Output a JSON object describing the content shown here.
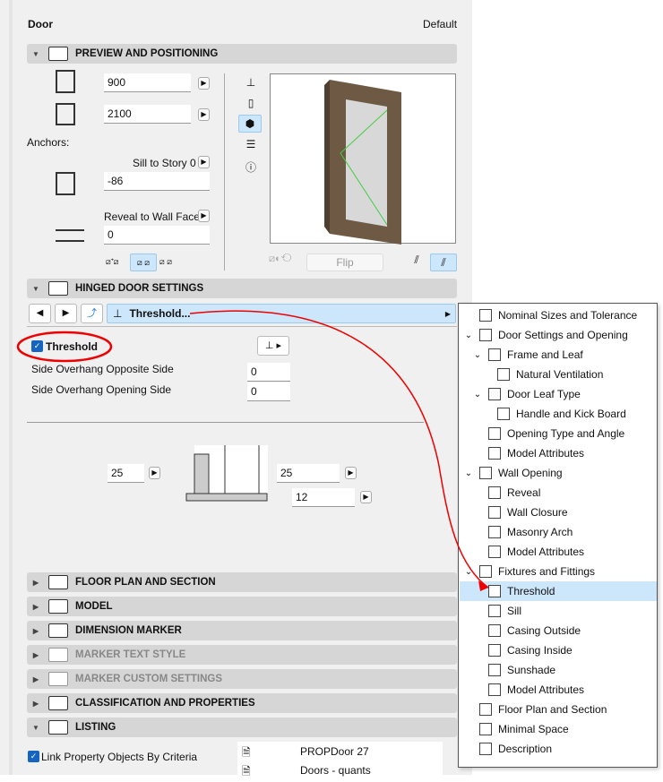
{
  "header": {
    "title": "Door",
    "preset": "Default"
  },
  "sections": {
    "preview": "PREVIEW AND POSITIONING",
    "hinged": "HINGED DOOR SETTINGS",
    "floor": "FLOOR PLAN AND SECTION",
    "model": "MODEL",
    "dimension": "DIMENSION MARKER",
    "marker_text": "MARKER TEXT STYLE",
    "marker_custom": "MARKER CUSTOM SETTINGS",
    "classification": "CLASSIFICATION AND PROPERTIES",
    "listing": "LISTING"
  },
  "preview": {
    "width": "900",
    "height": "2100",
    "anchors_label": "Anchors:",
    "sill_label": "Sill to Story 0",
    "sill_value": "-86",
    "reveal_label": "Reveal to Wall Face",
    "reveal_value": "0",
    "flip_label": "Flip"
  },
  "hinged": {
    "page_label": "Threshold...",
    "threshold_label": "Threshold",
    "threshold_checked": true,
    "opp_label": "Side Overhang Opposite Side",
    "opp_value": "0",
    "open_label": "Side Overhang Opening Side",
    "open_value": "0",
    "left_value": "25",
    "right_value": "25",
    "height_value": "12"
  },
  "listing": {
    "link_label": "Link Property Objects By Criteria",
    "link_checked": true,
    "items": [
      "PROPDoor 27",
      "Doors - quants"
    ]
  },
  "menu": {
    "items": [
      {
        "label": "Nominal Sizes and Tolerance",
        "level": 0,
        "chev": ""
      },
      {
        "label": "Door Settings and Opening",
        "level": 0,
        "chev": "⌄"
      },
      {
        "label": "Frame and Leaf",
        "level": 1,
        "chev": "⌄"
      },
      {
        "label": "Natural Ventilation",
        "level": 2,
        "chev": ""
      },
      {
        "label": "Door Leaf Type",
        "level": 1,
        "chev": "⌄"
      },
      {
        "label": "Handle and Kick Board",
        "level": 2,
        "chev": ""
      },
      {
        "label": "Opening Type and Angle",
        "level": 1,
        "chev": ""
      },
      {
        "label": "Model Attributes",
        "level": 1,
        "chev": ""
      },
      {
        "label": "Wall Opening",
        "level": 0,
        "chev": "⌄"
      },
      {
        "label": "Reveal",
        "level": 1,
        "chev": ""
      },
      {
        "label": "Wall Closure",
        "level": 1,
        "chev": ""
      },
      {
        "label": "Masonry Arch",
        "level": 1,
        "chev": ""
      },
      {
        "label": "Model Attributes",
        "level": 1,
        "chev": ""
      },
      {
        "label": "Fixtures and Fittings",
        "level": 0,
        "chev": "⌄"
      },
      {
        "label": "Threshold",
        "level": 1,
        "chev": "",
        "selected": true
      },
      {
        "label": "Sill",
        "level": 1,
        "chev": ""
      },
      {
        "label": "Casing Outside",
        "level": 1,
        "chev": ""
      },
      {
        "label": "Casing Inside",
        "level": 1,
        "chev": ""
      },
      {
        "label": "Sunshade",
        "level": 1,
        "chev": ""
      },
      {
        "label": "Model Attributes",
        "level": 1,
        "chev": ""
      },
      {
        "label": "Floor Plan and Section",
        "level": 0,
        "chev": ""
      },
      {
        "label": "Minimal Space",
        "level": 0,
        "chev": ""
      },
      {
        "label": "Description",
        "level": 0,
        "chev": ""
      }
    ]
  },
  "colors": {
    "accent": "#cce6fb",
    "annotation": "#e00000",
    "check": "#1565c0"
  }
}
